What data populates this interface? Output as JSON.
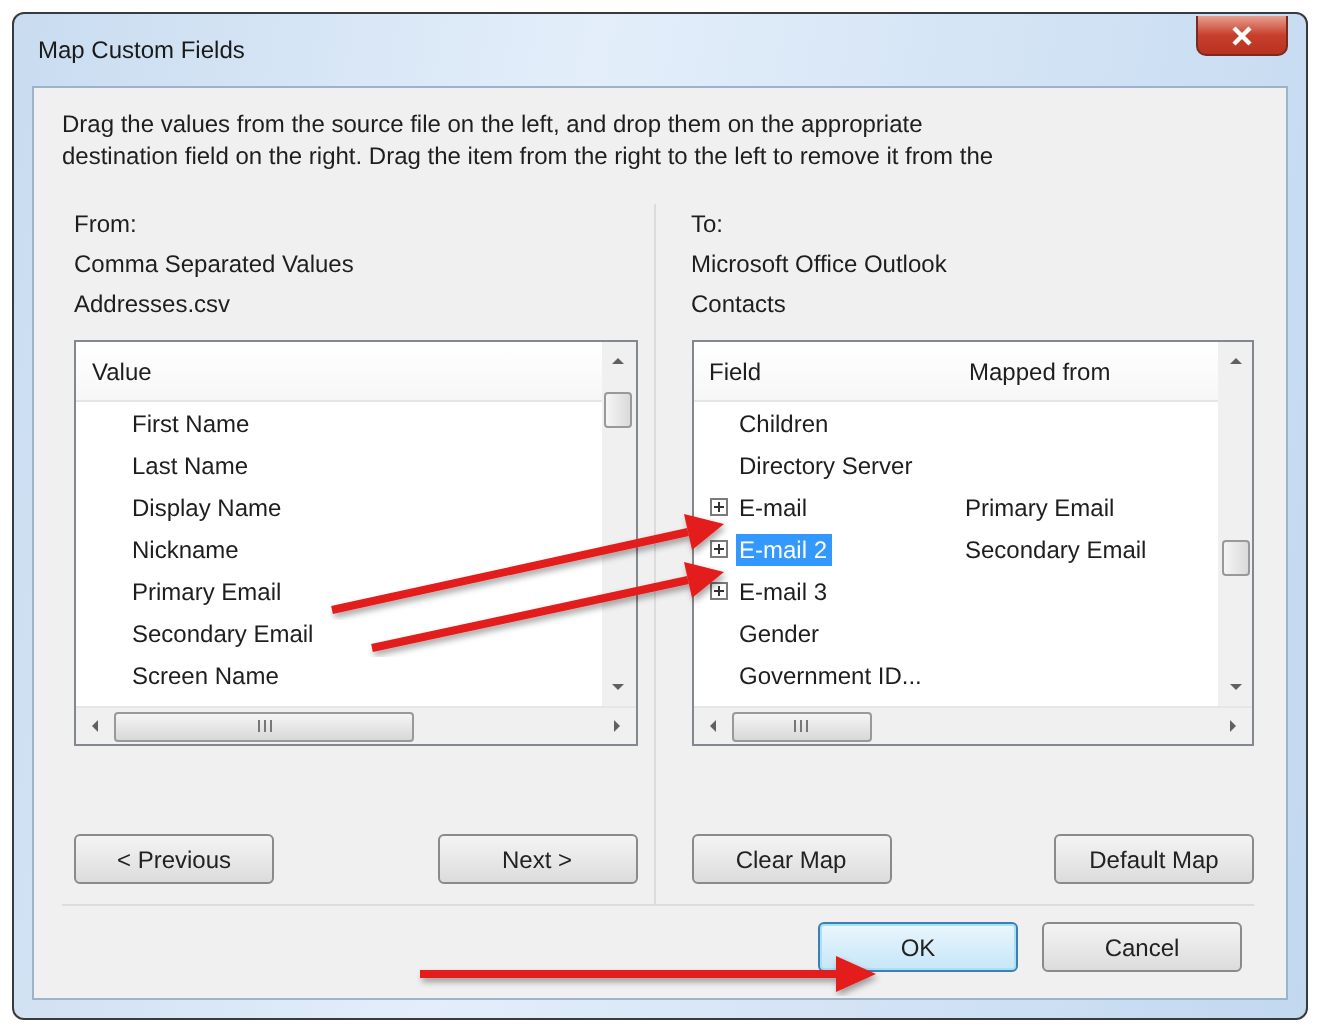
{
  "window": {
    "title": "Map Custom Fields"
  },
  "instruction_lines": [
    "Drag the values from the source file on the left, and drop them on the appropriate",
    "destination field on the right.  Drag the item from the right to the left to remove it from the"
  ],
  "source": {
    "label": "From:",
    "type": "Comma Separated Values",
    "file": "Addresses.csv",
    "list": {
      "column": "Value",
      "items": [
        "First Name",
        "Last Name",
        "Display Name",
        "Nickname",
        "Primary Email",
        "Secondary Email",
        "Screen Name"
      ]
    }
  },
  "destination": {
    "label": "To:",
    "application": "Microsoft Office Outlook",
    "folder": "Contacts",
    "list": {
      "columns": [
        "Field",
        "Mapped from"
      ],
      "rows": [
        {
          "field": "Children",
          "expandable": false,
          "selected": false
        },
        {
          "field": "Directory Server",
          "expandable": false,
          "selected": false
        },
        {
          "field": "E-mail",
          "mapped_from": "Primary Email",
          "expandable": true,
          "selected": false
        },
        {
          "field": "E-mail 2",
          "mapped_from": "Secondary Email",
          "expandable": true,
          "selected": true
        },
        {
          "field": "E-mail 3",
          "expandable": true,
          "selected": false
        },
        {
          "field": "Gender",
          "expandable": false,
          "selected": false
        },
        {
          "field": "Government ID...",
          "expandable": false,
          "selected": false
        }
      ]
    }
  },
  "source_buttons": [
    "< Previous",
    "Next >"
  ],
  "destination_buttons": [
    "Clear Map",
    "Default Map"
  ],
  "dialog_buttons": [
    {
      "label": "OK",
      "default": true
    },
    {
      "label": "Cancel",
      "default": false
    }
  ]
}
